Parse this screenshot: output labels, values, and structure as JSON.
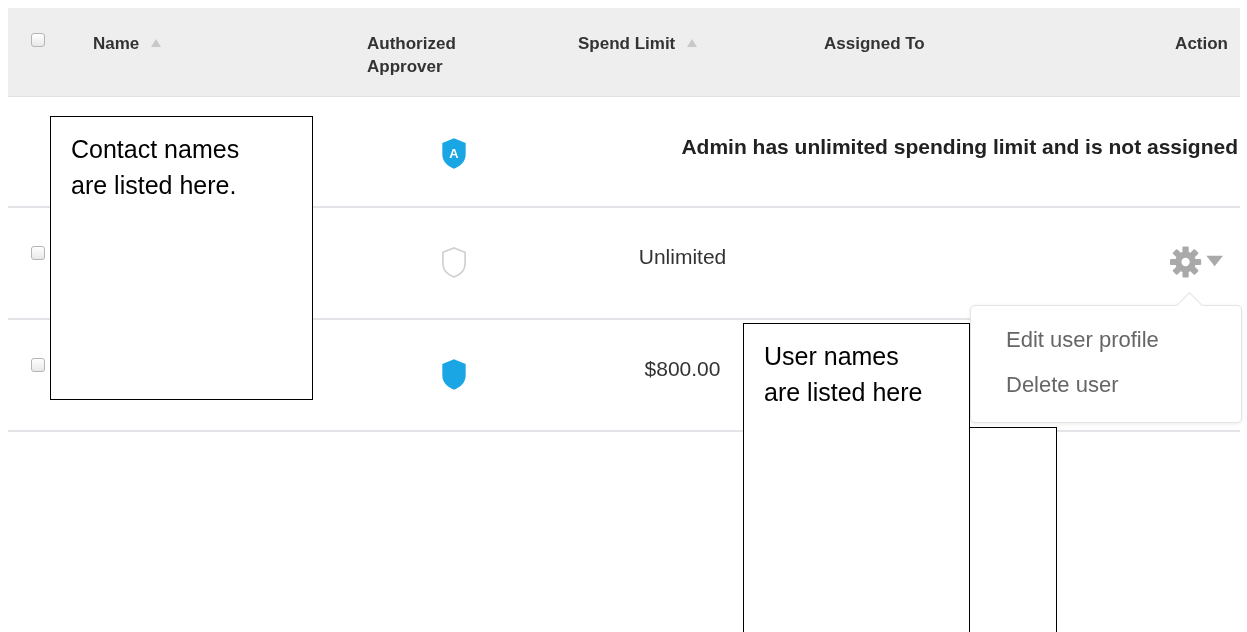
{
  "table": {
    "select_all": {
      "checked": false
    },
    "columns": [
      {
        "label": "Name",
        "sortable": true
      },
      {
        "label": "Authorized Approver",
        "sortable": false
      },
      {
        "label": "Spend Limit",
        "sortable": true
      },
      {
        "label": "Assigned To",
        "sortable": false
      },
      {
        "label": "Action",
        "sortable": false
      }
    ],
    "rows": [
      {
        "kind": "admin",
        "is_approver": true,
        "approver_badge": "A",
        "message": "Admin has unlimited spending limit and is not assigned"
      },
      {
        "kind": "user",
        "checked": false,
        "is_approver": false,
        "spend_limit": "Unlimited",
        "action_menu": true
      },
      {
        "kind": "user",
        "checked": false,
        "is_approver": true,
        "spend_limit": "$800.00",
        "action_menu": false
      }
    ]
  },
  "action_menu": {
    "items": [
      "Edit user profile",
      "Delete user"
    ]
  },
  "annotations": [
    {
      "kind": "note",
      "text": "Contact names are listed here."
    },
    {
      "kind": "note",
      "text": "User names are listed here"
    },
    {
      "kind": "blank"
    }
  ]
}
